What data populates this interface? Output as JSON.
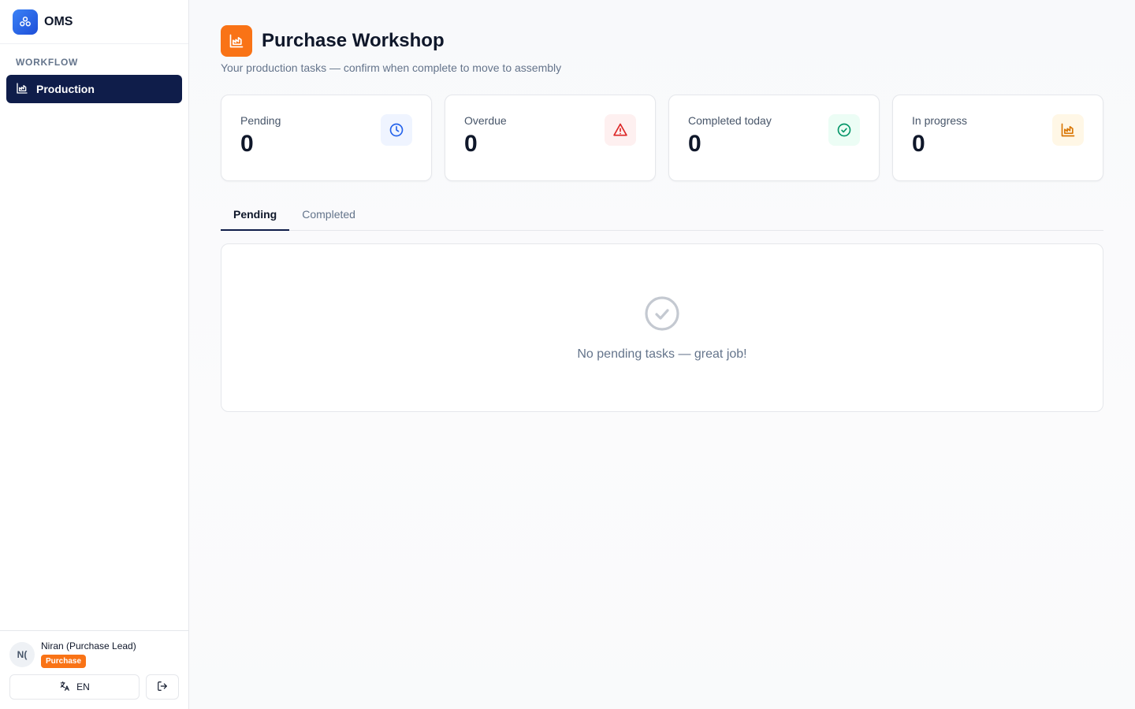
{
  "brand": {
    "name": "OMS"
  },
  "sidebar": {
    "section_heading": "WORKFLOW",
    "items": [
      {
        "label": "Production",
        "icon": "factory-icon",
        "active": true
      }
    ]
  },
  "user": {
    "initials": "N(",
    "name": "Niran (Purchase Lead)",
    "role": "Purchase"
  },
  "footer": {
    "language": "EN"
  },
  "header": {
    "title": "Purchase Workshop",
    "subtitle": "Your production tasks — confirm when complete to move to assembly"
  },
  "stats": [
    {
      "label": "Pending",
      "value": "0",
      "icon": "clock-icon",
      "color": "#2563eb",
      "bg": "#eff4ff"
    },
    {
      "label": "Overdue",
      "value": "0",
      "icon": "alert-triangle-icon",
      "color": "#dc2626",
      "bg": "#fef0f0"
    },
    {
      "label": "Completed today",
      "value": "0",
      "icon": "check-circle-icon",
      "color": "#059669",
      "bg": "#ecfdf5"
    },
    {
      "label": "In progress",
      "value": "0",
      "icon": "factory-icon",
      "color": "#d97706",
      "bg": "#fff7e6"
    }
  ],
  "tabs": [
    {
      "label": "Pending",
      "active": true
    },
    {
      "label": "Completed",
      "active": false
    }
  ],
  "empty_state": {
    "message": "No pending tasks — great job!"
  },
  "colors": {
    "accent": "#f97316",
    "nav_active": "#0f1d4a"
  }
}
